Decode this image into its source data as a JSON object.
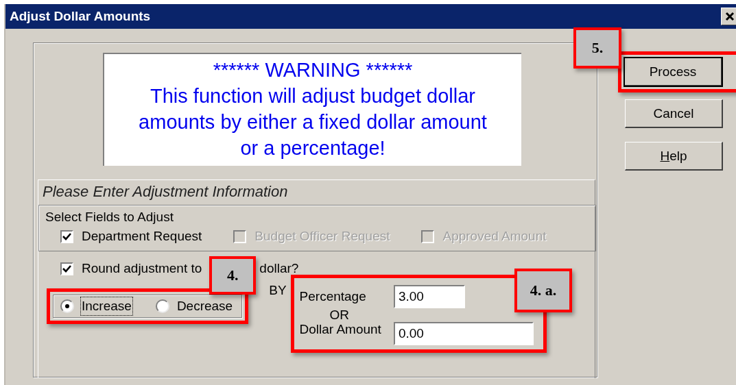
{
  "window": {
    "title": "Adjust Dollar Amounts"
  },
  "warning": {
    "text": "****** WARNING ******\nThis function will adjust budget dollar\namounts by either a fixed dollar amount\nor a percentage!"
  },
  "adjustment": {
    "title": "Please Enter Adjustment Information",
    "fields_group": {
      "title": "Select Fields to Adjust",
      "fields": [
        {
          "label": "Department Request",
          "checked": true,
          "disabled": false
        },
        {
          "label": "Budget Officer Request",
          "checked": false,
          "disabled": true
        },
        {
          "label": "Approved Amount",
          "checked": false,
          "disabled": true
        }
      ]
    },
    "round": {
      "label_parts": [
        "Round adjustment to",
        "dollar?"
      ],
      "checked": true
    },
    "direction": [
      {
        "label": "Increase",
        "selected": true
      },
      {
        "label": "Decrease",
        "selected": false
      }
    ],
    "by_label": "BY",
    "percentage": {
      "label": "Percentage",
      "value": "3.00"
    },
    "or_label": "OR",
    "dollar_amount": {
      "label": "Dollar Amount",
      "value": "0.00"
    }
  },
  "buttons": [
    {
      "label": "Process",
      "default": true
    },
    {
      "label": "Cancel",
      "default": false
    },
    {
      "label_parts": [
        {
          "text": "H",
          "underlined": true
        },
        {
          "text": "elp",
          "underlined": false
        }
      ],
      "default": false
    }
  ],
  "callouts": {
    "process": "5.",
    "direction": "4.",
    "amounts": "4. a."
  }
}
